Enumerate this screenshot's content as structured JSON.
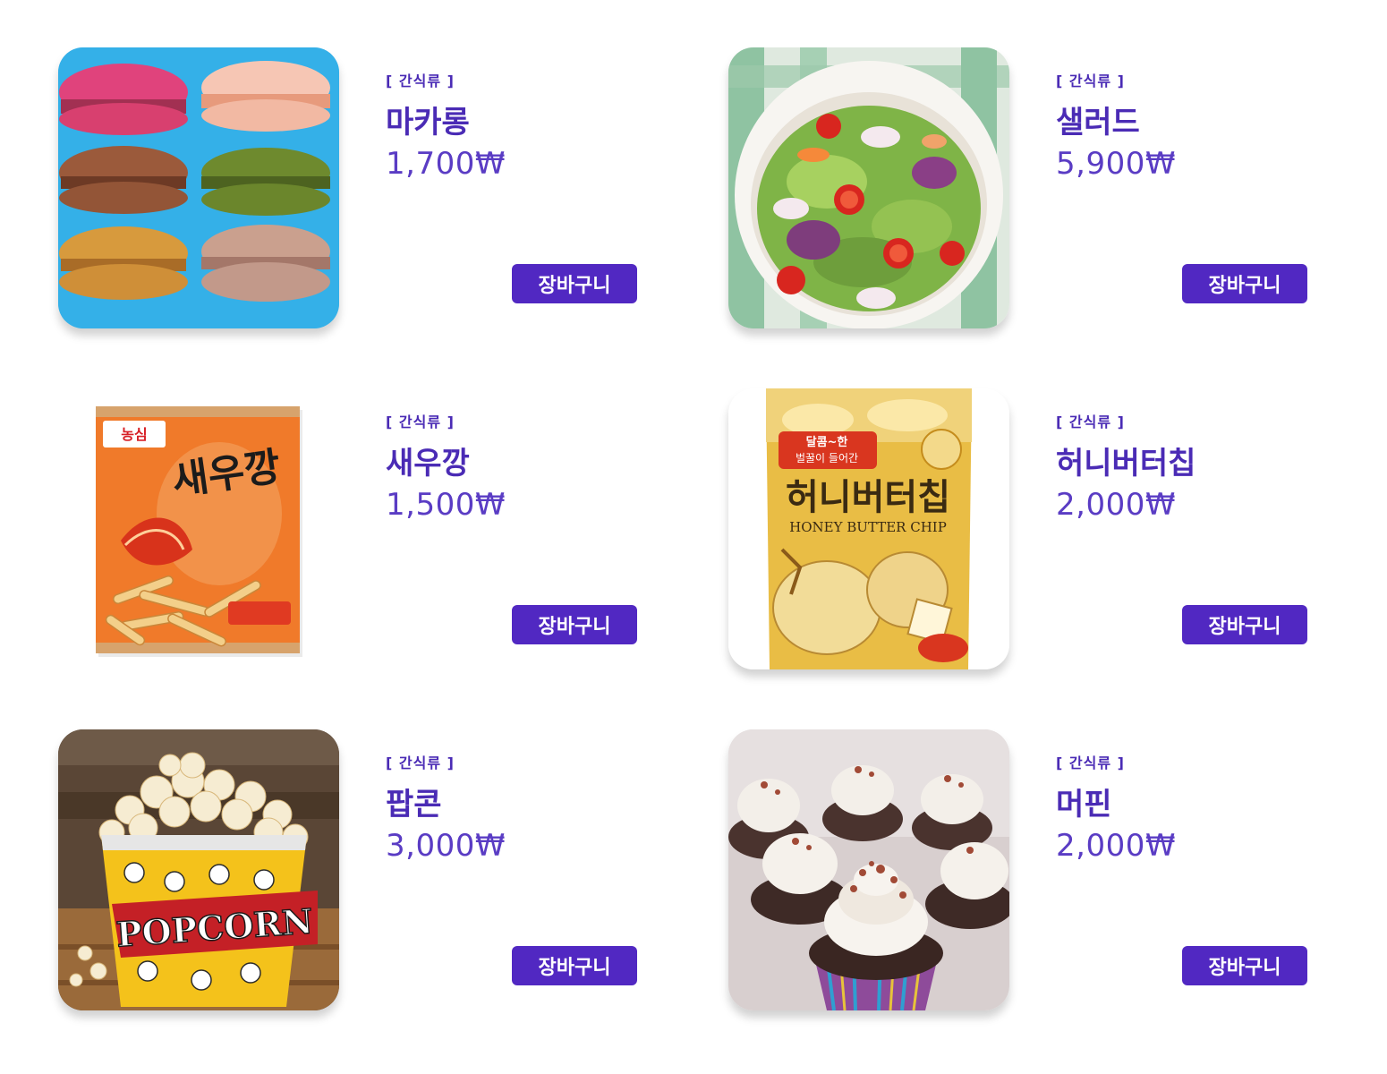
{
  "products": [
    {
      "category": "[ 간식류 ]",
      "name": "마카롱",
      "price": "1,700₩",
      "cart_label": "장바구니"
    },
    {
      "category": "[ 간식류 ]",
      "name": "샐러드",
      "price": "5,900₩",
      "cart_label": "장바구니"
    },
    {
      "category": "[ 간식류 ]",
      "name": "새우깡",
      "price": "1,500₩",
      "cart_label": "장바구니",
      "package_text": {
        "brand": "농심",
        "title": "새우깡"
      }
    },
    {
      "category": "[ 간식류 ]",
      "name": "허니버터칩",
      "price": "2,000₩",
      "cart_label": "장바구니",
      "package_text": {
        "top": "달콤~한",
        "sub": "벌꿀이 들어간",
        "title": "허니버터칩",
        "english": "HONEY BUTTER CHIP"
      }
    },
    {
      "category": "[ 간식류 ]",
      "name": "팝콘",
      "price": "3,000₩",
      "cart_label": "장바구니",
      "package_text": {
        "title": "POPCORN"
      }
    },
    {
      "category": "[ 간식류 ]",
      "name": "머핀",
      "price": "2,000₩",
      "cart_label": "장바구니"
    }
  ],
  "colors": {
    "accent": "#5128c2",
    "text": "#4a2bb5"
  }
}
